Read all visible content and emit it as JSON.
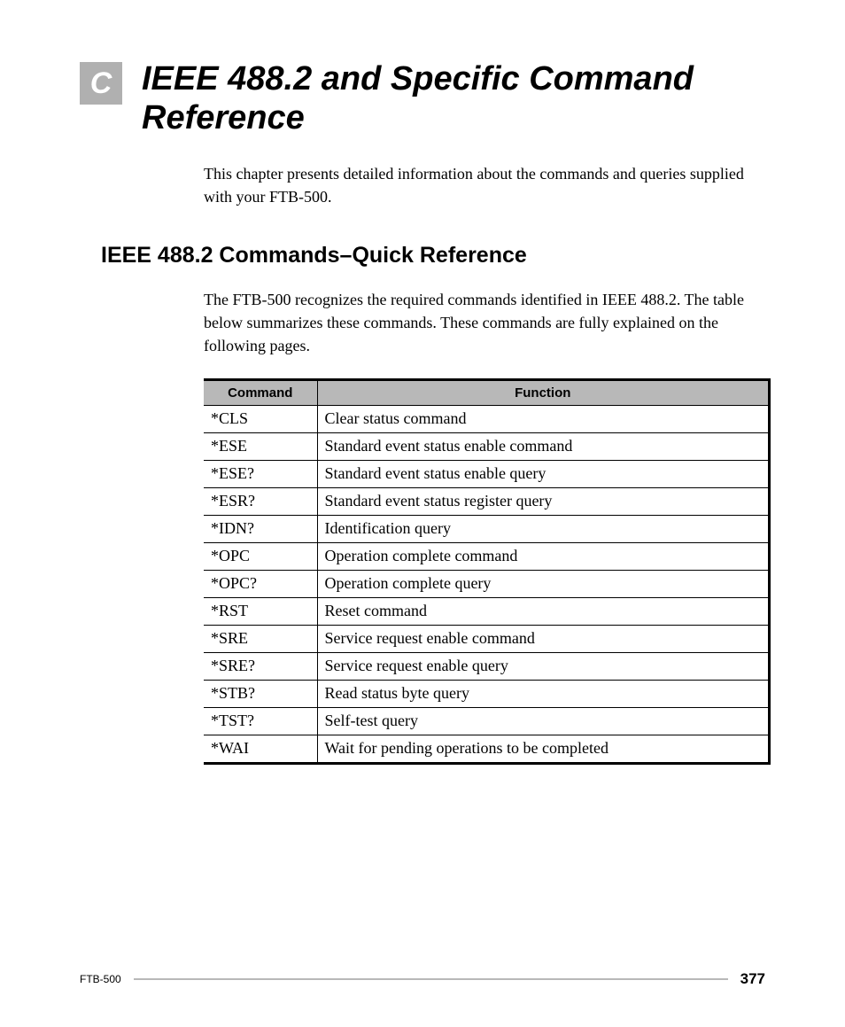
{
  "chapter": {
    "letter": "C",
    "title": "IEEE 488.2 and Specific Command Reference"
  },
  "intro": "This chapter presents detailed information about the commands and queries supplied with your FTB-500.",
  "section": {
    "heading": "IEEE 488.2 Commands–Quick Reference",
    "text": "The FTB-500 recognizes the required commands identified in IEEE 488.2. The table below summarizes these commands. These commands are fully explained on the following pages."
  },
  "table": {
    "headers": {
      "command": "Command",
      "function": "Function"
    },
    "rows": [
      {
        "command": "*CLS",
        "function": "Clear status command"
      },
      {
        "command": "*ESE",
        "function": "Standard event status enable command"
      },
      {
        "command": "*ESE?",
        "function": "Standard event status enable query"
      },
      {
        "command": "*ESR?",
        "function": "Standard event status register query"
      },
      {
        "command": "*IDN?",
        "function": "Identification query"
      },
      {
        "command": "*OPC",
        "function": "Operation complete command"
      },
      {
        "command": "*OPC?",
        "function": "Operation complete query"
      },
      {
        "command": "*RST",
        "function": "Reset command"
      },
      {
        "command": "*SRE",
        "function": "Service request enable command"
      },
      {
        "command": "*SRE?",
        "function": "Service request enable query"
      },
      {
        "command": "*STB?",
        "function": "Read status byte query"
      },
      {
        "command": "*TST?",
        "function": "Self-test query"
      },
      {
        "command": "*WAI",
        "function": "Wait for pending operations to be completed"
      }
    ]
  },
  "footer": {
    "model": "FTB-500",
    "page": "377"
  }
}
